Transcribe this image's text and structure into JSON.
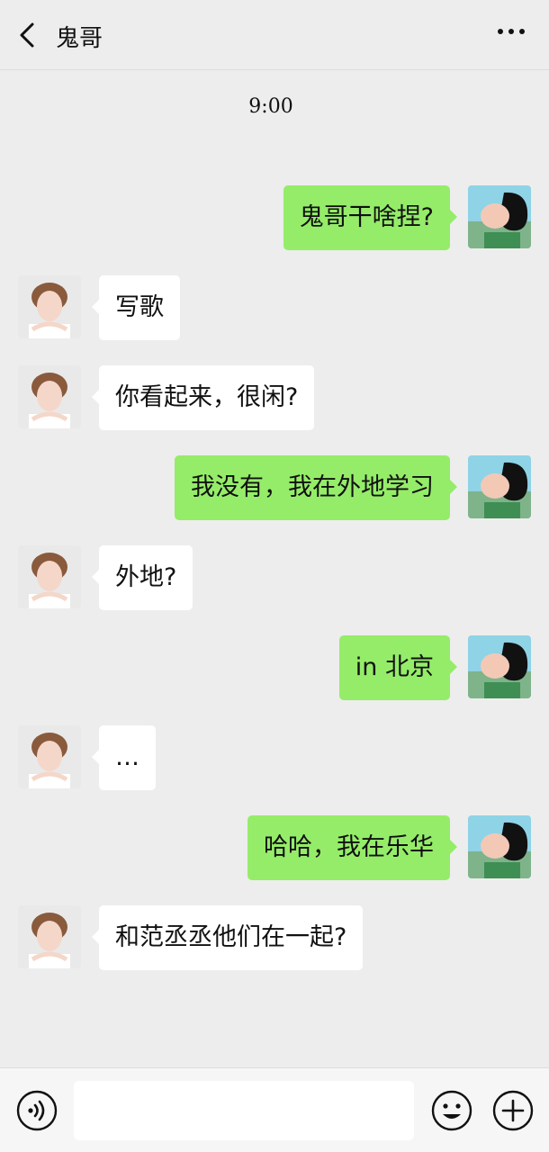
{
  "header": {
    "title": "鬼哥",
    "back_icon": "chevron-left-icon",
    "more_icon": "more-dots-icon"
  },
  "timestamp": "9:00",
  "contact_avatar": "contact-avatar",
  "self_avatar": "self-avatar",
  "messages": [
    {
      "side": "right",
      "text": "鬼哥干啥捏?"
    },
    {
      "side": "left",
      "text": "写歌"
    },
    {
      "side": "left",
      "text": "你看起来，很闲?"
    },
    {
      "side": "right",
      "text": "我没有，我在外地学习"
    },
    {
      "side": "left",
      "text": "外地?"
    },
    {
      "side": "right",
      "text": "in 北京"
    },
    {
      "side": "left",
      "text": "…"
    },
    {
      "side": "right",
      "text": "哈哈，我在乐华"
    },
    {
      "side": "left",
      "text": "和范丞丞他们在一起?"
    }
  ],
  "input": {
    "value": "",
    "voice_icon": "voice-icon",
    "emoji_icon": "emoji-icon",
    "plus_icon": "plus-icon"
  },
  "colors": {
    "background": "#ededed",
    "bubble_self": "#95ec69",
    "bubble_contact": "#ffffff"
  }
}
